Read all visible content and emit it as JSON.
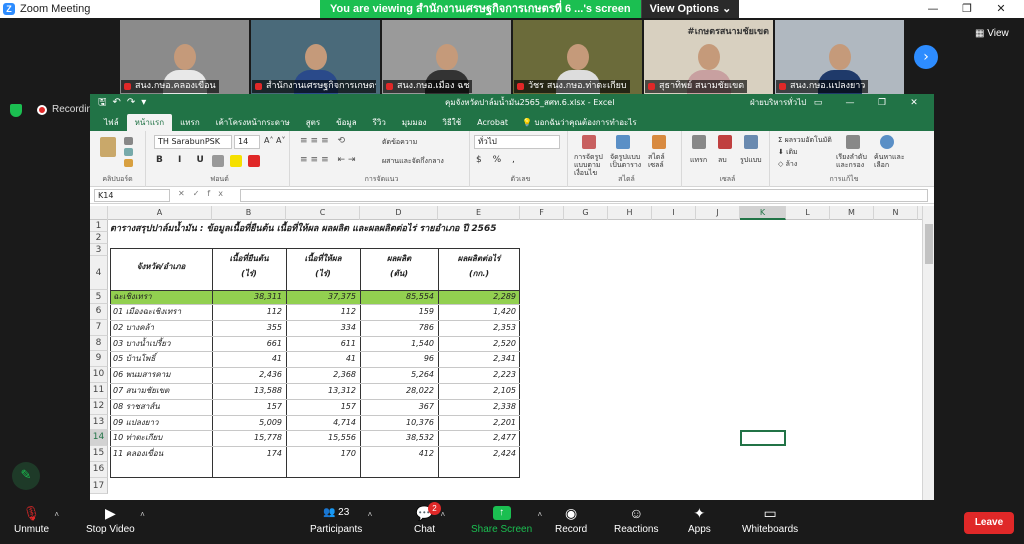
{
  "zoom": {
    "window_title": "Zoom Meeting",
    "viewing_banner": "You are viewing สำนักงานเศรษฐกิจการเกษตรที่ 6 ...'s screen",
    "view_options_label": "View Options",
    "view_label": "View",
    "recording_label": "Recording",
    "participants": [
      {
        "name": "สนง.กษอ.คลองเขื่อน",
        "bg": "#8b8b8b",
        "shirt": "#e8e8e8"
      },
      {
        "name": "สำนักงานเศรษฐกิจการเกษตรที่...",
        "bg": "#4a6a7a",
        "shirt": "#2a4a8a"
      },
      {
        "name": "สนง.กษอ.เมือง ฉช",
        "bg": "#9a9a9a",
        "shirt": "#333"
      },
      {
        "name": "วัชร สนง.กษอ.ท่าตะเกียบ",
        "bg": "#6b6b3a",
        "shirt": "#ddd"
      },
      {
        "name": "สุธาทิพย์ สนามชัยเขต",
        "bg": "#d8d0c0",
        "shirt": "#c8a0a0"
      },
      {
        "name": "สนง.กษอ.แปลงยาว",
        "bg": "#b0b8c0",
        "shirt": "#1f3a6a"
      }
    ],
    "tile_overlay_text": "#เกษตรสนามชัยเขต",
    "toolbar": {
      "unmute": "Unmute",
      "stop_video": "Stop Video",
      "participants": "Participants",
      "participant_count": "23",
      "chat": "Chat",
      "chat_badge": "2",
      "share_screen": "Share Screen",
      "record": "Record",
      "reactions": "Reactions",
      "apps": "Apps",
      "whiteboards": "Whiteboards",
      "leave": "Leave"
    }
  },
  "excel": {
    "file_name": "คุมจังหวัดปาล์มน้ำมัน2565_สศท.6.xlsx  -  Excel",
    "user_name": "ฝ่ายบริหารทั่วไป",
    "tabs": [
      "ไฟล์",
      "หน้าแรก",
      "แทรก",
      "เค้าโครงหน้ากระดาษ",
      "สูตร",
      "ข้อมูล",
      "รีวิว",
      "มุมมอง",
      "วิธีใช้",
      "Acrobat"
    ],
    "active_tab": "หน้าแรก",
    "tell_me": "บอกฉันว่าคุณต้องการทำอะไร",
    "ribbon": {
      "font_name": "TH SarabunPSK",
      "font_size": "14",
      "number_format": "ทั่วไป",
      "wrap_text": "ตัดข้อความ",
      "merge_center": "ผสานและจัดกึ่งกลาง",
      "cond_format": "การจัดรูปแบบตามเงื่อนไข",
      "format_table": "จัดรูปแบบเป็นตาราง",
      "cell_styles": "สไตล์เซลล์",
      "insert": "แทรก",
      "delete": "ลบ",
      "format": "รูปแบบ",
      "autosum": "ผลรวมอัตโนมัติ",
      "fill": "เติม",
      "clear": "ล้าง",
      "sort_filter": "เรียงลำดับและกรอง",
      "find_select": "ค้นหาและเลือก",
      "groups": {
        "clipboard": "คลิปบอร์ด",
        "font": "ฟอนต์",
        "alignment": "การจัดแนว",
        "number": "ตัวเลข",
        "styles": "สไตล์",
        "cells": "เซลล์",
        "editing": "การแก้ไข"
      }
    },
    "name_box": "K14",
    "columns": [
      "A",
      "B",
      "C",
      "D",
      "E",
      "F",
      "G",
      "H",
      "I",
      "J",
      "K",
      "L",
      "M",
      "N"
    ],
    "selected_column": "K",
    "selected_row": "14",
    "rows": [
      "1",
      "2",
      "3",
      "4",
      "5",
      "6",
      "7",
      "8",
      "9",
      "10",
      "11",
      "12",
      "13",
      "14",
      "15",
      "16",
      "17"
    ],
    "sheet_title": "ตารางสรุปปาล์มน้ำมัน : ข้อมูลเนื้อที่ยืนต้น เนื้อที่ให้ผล ผลผลิต และผลผลิตต่อไร่ รายอำเภอ ปี 2565",
    "table_headers": {
      "district": "จังหวัด/อำเภอ",
      "planted": "เนื้อที่ยืนต้น",
      "planted_unit": "(ไร่)",
      "harvested": "เนื้อที่ให้ผล",
      "harvested_unit": "(ไร่)",
      "production": "ผลผลิต",
      "production_unit": "(ตัน)",
      "yield": "ผลผลิตต่อไร่",
      "yield_unit": "(กก.)"
    },
    "table_rows": [
      {
        "name": "ฉะเชิงเทรา",
        "planted": "38,311",
        "harvested": "37,375",
        "production": "85,554",
        "yield": "2,289",
        "total": true
      },
      {
        "name": "01 เมืองฉะเชิงเทรา",
        "planted": "112",
        "harvested": "112",
        "production": "159",
        "yield": "1,420"
      },
      {
        "name": "02 บางคล้า",
        "planted": "355",
        "harvested": "334",
        "production": "786",
        "yield": "2,353"
      },
      {
        "name": "03 บางน้ำเปรี้ยว",
        "planted": "661",
        "harvested": "611",
        "production": "1,540",
        "yield": "2,520"
      },
      {
        "name": "05 บ้านโพธิ์",
        "planted": "41",
        "harvested": "41",
        "production": "96",
        "yield": "2,341"
      },
      {
        "name": "06 พนมสารคาม",
        "planted": "2,436",
        "harvested": "2,368",
        "production": "5,264",
        "yield": "2,223"
      },
      {
        "name": "07 สนามชัยเขต",
        "planted": "13,588",
        "harvested": "13,312",
        "production": "28,022",
        "yield": "2,105"
      },
      {
        "name": "08 ราชสาส์น",
        "planted": "157",
        "harvested": "157",
        "production": "367",
        "yield": "2,338"
      },
      {
        "name": "09 แปลงยาว",
        "planted": "5,009",
        "harvested": "4,714",
        "production": "10,376",
        "yield": "2,201"
      },
      {
        "name": "10 ท่าตะเกียบ",
        "planted": "15,778",
        "harvested": "15,556",
        "production": "38,532",
        "yield": "2,477"
      },
      {
        "name": "11 คลองเขื่อน",
        "planted": "174",
        "harvested": "170",
        "production": "412",
        "yield": "2,424"
      }
    ]
  }
}
